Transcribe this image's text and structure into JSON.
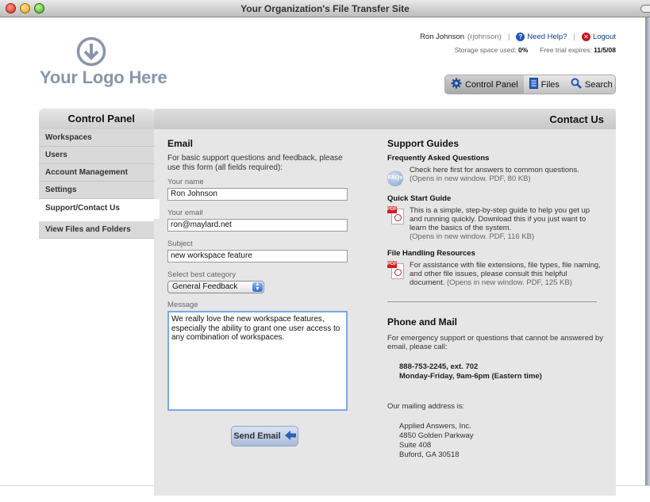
{
  "window": {
    "title": "Your Organization's File Transfer Site"
  },
  "logo": {
    "text": "Your Logo Here"
  },
  "userbar": {
    "name": "Ron Johnson",
    "username": "(rjohnson)",
    "help_label": "Need Help?",
    "logout_label": "Logout",
    "storage_label": "Storage space used:",
    "storage_value": "0%",
    "trial_label": "Free trial expires:",
    "trial_value": "11/5/08"
  },
  "tabs": [
    {
      "label": "Control Panel",
      "icon": "gear-icon",
      "active": true
    },
    {
      "label": "Files",
      "icon": "document-icon",
      "active": false
    },
    {
      "label": "Search",
      "icon": "magnifier-icon",
      "active": false
    }
  ],
  "sidebar": {
    "title": "Control Panel",
    "items": [
      {
        "label": "Workspaces"
      },
      {
        "label": "Users"
      },
      {
        "label": "Account Management"
      },
      {
        "label": "Settings"
      },
      {
        "label": "Support/Contact Us",
        "active": true
      },
      {
        "label": "View Files and Folders"
      }
    ]
  },
  "main": {
    "title": "Contact Us",
    "email": {
      "heading": "Email",
      "intro": "For basic support questions and feedback, please use this form (all fields required):",
      "name_label": "Your name",
      "name_value": "Ron Johnson",
      "email_label": "Your email",
      "email_value": "ron@maylard.net",
      "subject_label": "Subject",
      "subject_value": "new workspace feature",
      "category_label": "Select best category",
      "category_value": "General Feedback",
      "message_label": "Message",
      "message_value": "We really love the new workspace features, especially the ability to grant one user access to any combination of workspaces.",
      "send_label": "Send Email"
    },
    "guides": {
      "heading": "Support Guides",
      "faq_title": "Frequently Asked Questions",
      "faq_icon_text": "FAQs",
      "faq_text": "Check here first for answers to common questions.",
      "faq_note": "(Opens in new window. PDF, 80 KB)",
      "quick_title": "Quick Start Guide",
      "quick_text": "This is a simple, step-by-step guide to help you get up and running quickly. Download this if you just want to learn the basics of the system.",
      "quick_note": "(Opens in new window. PDF, 116 KB)",
      "files_title": "File Handling Resources",
      "files_text": "For assistance with file extensions, file types, file naming, and other file issues, please consult this helpful document.",
      "files_note": "(Opens in new window. PDF, 125 KB)",
      "pdf_badge": "PDF"
    },
    "phone": {
      "heading": "Phone and Mail",
      "intro": "For emergency support or questions that cannot be answered by email, please call:",
      "number": "888-753-2245, ext. 702",
      "hours": "Monday-Friday, 9am-6pm (Eastern time)",
      "mail_intro": "Our mailing address is:",
      "address": [
        "Applied Answers, Inc.",
        "4850 Golden Parkway",
        "Suite 408",
        "Buford, GA 30518"
      ]
    }
  }
}
